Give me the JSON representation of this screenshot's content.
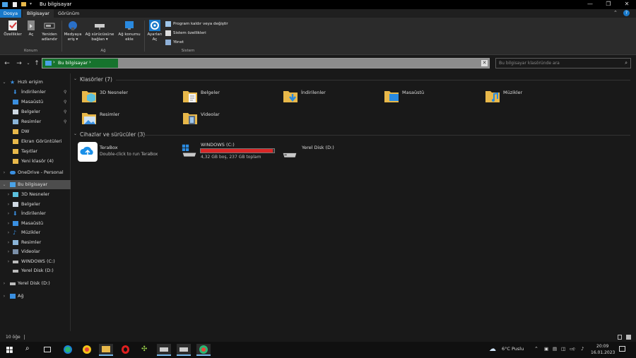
{
  "window": {
    "title": "Bu bilgisayar",
    "controls": {
      "minimize": "—",
      "maximize": "❐",
      "close": "✕"
    }
  },
  "tabs": [
    {
      "label": "Dosya",
      "selected": false
    },
    {
      "label": "Bilgisayar",
      "selected": true
    },
    {
      "label": "Görünüm",
      "selected": false
    }
  ],
  "ribbon": {
    "groups": {
      "location": "Konum",
      "network": "Ağ",
      "system": "Sistem"
    },
    "buttons": {
      "properties": "Özellikler",
      "open": "Aç",
      "rename_line1": "Yeniden",
      "rename_line2": "adlandır",
      "media_line1": "Medyaya",
      "media_line2": "eriş ▾",
      "map_drive_line1": "Ağ sürücüsüne",
      "map_drive_line2": "bağlan ▾",
      "add_location_line1": "Ağ konumu",
      "add_location_line2": "ekle",
      "settings_line1": "Ayarları",
      "settings_line2": "Aç",
      "uninstall": "Program kaldır veya değiştir",
      "system_props": "Sistem özellikleri",
      "manage": "Yönet"
    }
  },
  "address": {
    "path": "Bu bilgisayar",
    "separator": "›",
    "search_placeholder": "Bu bilgisayar klasöründe ara"
  },
  "nav": {
    "quick_access": "Hızlı erişim",
    "quick_items": [
      {
        "label": "İndirilenler",
        "pinned": true
      },
      {
        "label": "Masaüstü",
        "pinned": true
      },
      {
        "label": "Belgeler",
        "pinned": true
      },
      {
        "label": "Resimler",
        "pinned": true
      },
      {
        "label": "DW",
        "pinned": false
      },
      {
        "label": "Ekran Görüntüleri",
        "pinned": false
      },
      {
        "label": "Taşıtlar",
        "pinned": false
      },
      {
        "label": "Yeni klasör (4)",
        "pinned": false
      }
    ],
    "onedrive": "OneDrive - Personal",
    "this_pc": "Bu bilgisayar",
    "pc_items": [
      "3D Nesneler",
      "Belgeler",
      "İndirilenler",
      "Masaüstü",
      "Müzikler",
      "Resimler",
      "Videolar",
      "WINDOWS (C:)",
      "Yerel Disk (D:)"
    ],
    "local_disk": "Yerel Disk (D:)",
    "network": "Ağ",
    "pin_glyph": "📌"
  },
  "content": {
    "folders_header": "Klasörler (7)",
    "folders": [
      "3D Nesneler",
      "Belgeler",
      "İndirilenler",
      "Masaüstü",
      "Müzikler",
      "Resimler",
      "Videolar"
    ],
    "devices_header": "Cihazlar ve sürücüler (3)",
    "terabox": {
      "name": "TeraBox",
      "desc": "Double-click to run TeraBox"
    },
    "c_drive": {
      "name": "WINDOWS (C:)",
      "free": "4,32 GB boş, 237 GB toplam",
      "used_fraction": 0.982
    },
    "d_drive": {
      "name": "Yerel Disk (D:)"
    }
  },
  "status": {
    "count": "10 öğe"
  },
  "taskbar": {
    "weather": "6°C  Puslu",
    "time": "20:09",
    "date": "16.01.2023"
  },
  "colors": {
    "accent": "#1979ca",
    "address_highlight": "#16732d",
    "drive_full": "#da2626",
    "folder": "#e8b84a"
  }
}
